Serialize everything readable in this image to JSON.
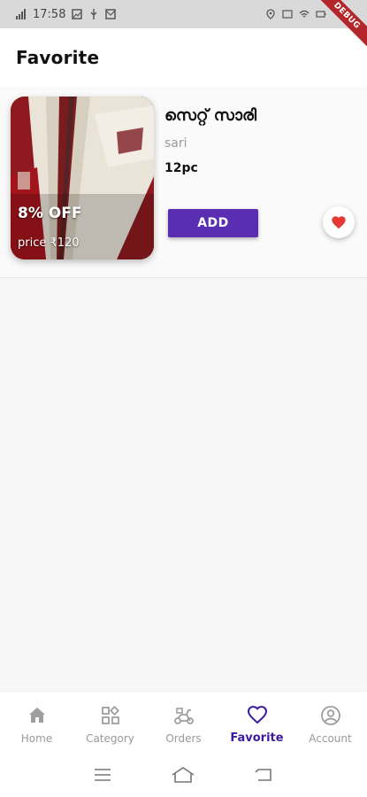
{
  "status_bar": {
    "time": "17:58",
    "debug_label": "DEBUG"
  },
  "app_bar": {
    "title": "Favorite"
  },
  "favorites": [
    {
      "name": "സെറ്റ് സാരി",
      "category": "sari",
      "quantity": "12pc",
      "discount": "8% OFF",
      "price": "price ₹120",
      "add_label": "ADD",
      "favorited": true
    }
  ],
  "bottom_nav": {
    "items": [
      {
        "label": "Home",
        "icon": "home-icon",
        "active": false
      },
      {
        "label": "Category",
        "icon": "category-icon",
        "active": false
      },
      {
        "label": "Orders",
        "icon": "delivery-scooter-icon",
        "active": false
      },
      {
        "label": "Favorite",
        "icon": "heart-outline-icon",
        "active": true
      },
      {
        "label": "Account",
        "icon": "account-circle-icon",
        "active": false
      }
    ]
  },
  "colors": {
    "accent": "#5b2db0",
    "active_nav": "#3b1c9e",
    "heart": "#e53935",
    "debug_ribbon": "#b3262a"
  }
}
